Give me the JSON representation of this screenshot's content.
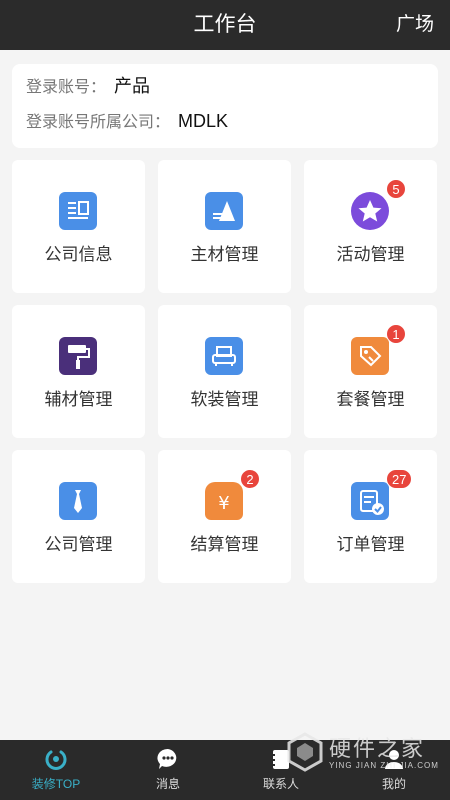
{
  "header": {
    "title": "工作台",
    "right_link": "广场"
  },
  "account": {
    "username_label": "登录账号：",
    "username_value": "产品",
    "company_label": "登录账号所属公司：",
    "company_value": "MDLK"
  },
  "cards": [
    {
      "label": "公司信息",
      "icon": "document-icon",
      "color": "#4a8fe7"
    },
    {
      "label": "主材管理",
      "icon": "materials-icon",
      "color": "#4a8fe7"
    },
    {
      "label": "活动管理",
      "icon": "star-icon",
      "color": "#7c4bdb",
      "badge": "5"
    },
    {
      "label": "辅材管理",
      "icon": "paint-roller-icon",
      "color": "#4a2f7a"
    },
    {
      "label": "软装管理",
      "icon": "sofa-icon",
      "color": "#4a8fe7"
    },
    {
      "label": "套餐管理",
      "icon": "price-tag-icon",
      "color": "#f08a3c",
      "badge": "1"
    },
    {
      "label": "公司管理",
      "icon": "tie-icon",
      "color": "#4a8fe7"
    },
    {
      "label": "结算管理",
      "icon": "money-bag-icon",
      "color": "#f08a3c",
      "badge": "2"
    },
    {
      "label": "订单管理",
      "icon": "order-icon",
      "color": "#4a8fe7",
      "badge": "27"
    }
  ],
  "tabbar": {
    "tabs": [
      {
        "label": "装修TOP",
        "icon": "home-ring-icon",
        "active": true
      },
      {
        "label": "消息",
        "icon": "message-icon",
        "active": false
      },
      {
        "label": "联系人",
        "icon": "contacts-icon",
        "active": false
      },
      {
        "label": "我的",
        "icon": "profile-icon",
        "active": false
      }
    ],
    "active_color": "#3ab0c8"
  },
  "watermark": {
    "title": "硬件之家",
    "subtitle": "YING JIAN ZHI JIA.COM"
  }
}
